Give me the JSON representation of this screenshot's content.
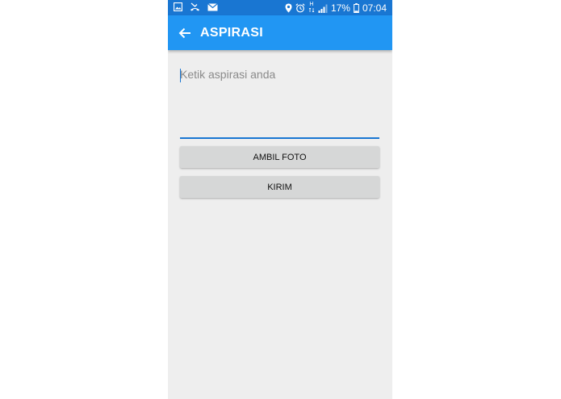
{
  "status_bar": {
    "battery": "17%",
    "time": "07:04",
    "network_label": "H",
    "left_icons": [
      "gallery-icon",
      "missed-call-icon",
      "mail-icon"
    ],
    "right_icons": [
      "location-icon",
      "alarm-icon",
      "signal-icon",
      "battery-icon"
    ]
  },
  "app_bar": {
    "title": "ASPIRASI",
    "back_icon": "back-arrow-icon"
  },
  "form": {
    "aspiration_placeholder": "Ketik aspirasi anda",
    "aspiration_value": ""
  },
  "buttons": {
    "take_photo_label": "AMBIL FOTO",
    "send_label": "KIRIM"
  },
  "colors": {
    "status_bar": "#1976d2",
    "app_bar": "#2196f3",
    "background": "#eeeeee",
    "button": "#d6d7d7",
    "input_underline": "#1976d2"
  }
}
